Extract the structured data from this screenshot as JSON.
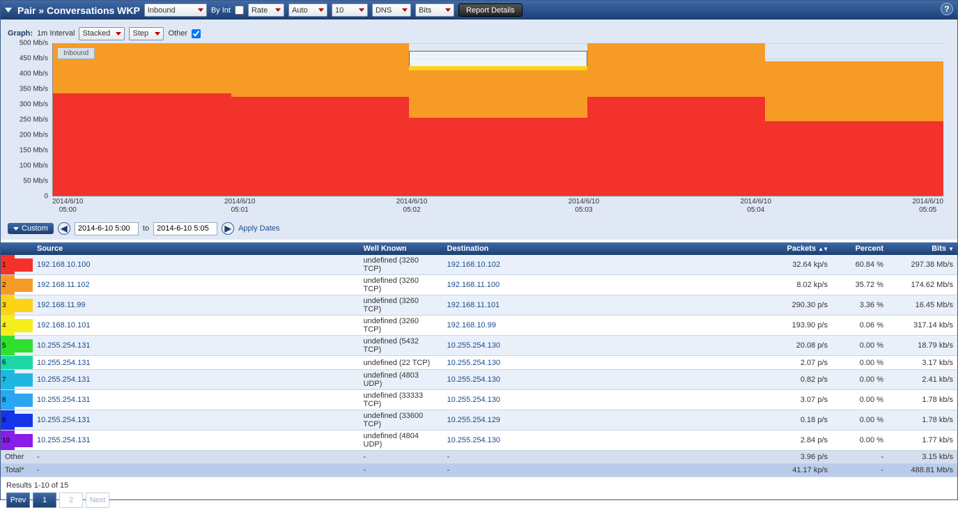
{
  "topbar": {
    "title": "Pair » Conversations WKP",
    "direction": "Inbound",
    "by_int_label": "By Int",
    "by_int_checked": false,
    "rate": "Rate",
    "auto": "Auto",
    "count": "10",
    "dns": "DNS",
    "units": "Bits",
    "report_btn": "Report Details"
  },
  "graph_ctrl": {
    "label": "Graph:",
    "interval": "1m Interval",
    "stack": "Stacked",
    "step": "Step",
    "other_label": "Other",
    "other_checked": true,
    "legend": "Inbound"
  },
  "chart_data": {
    "type": "area",
    "title": "",
    "xlabel": "",
    "ylabel": "",
    "ylim": [
      0,
      500
    ],
    "y_unit": "Mb/s",
    "y_ticks": [
      0,
      50,
      100,
      150,
      200,
      250,
      300,
      350,
      400,
      450,
      500
    ],
    "categories": [
      "2014/6/10 05:00",
      "2014/6/10 05:01",
      "2014/6/10 05:02",
      "2014/6/10 05:03",
      "2014/6/10 05:04",
      "2014/6/10 05:05"
    ],
    "series": [
      {
        "name": "192.168.10.100",
        "color": "#f3322c",
        "values": [
          335,
          325,
          255,
          325,
          245
        ]
      },
      {
        "name": "192.168.11.102",
        "color": "#f79b27",
        "values": [
          165,
          175,
          155,
          175,
          195
        ]
      },
      {
        "name": "192.168.11.99",
        "color": "#fdd315",
        "values": [
          0,
          0,
          15,
          0,
          0
        ]
      },
      {
        "name": "outline_total",
        "color": "#666",
        "values": [
          500,
          500,
          475,
          500,
          440
        ]
      }
    ]
  },
  "date_row": {
    "custom": "Custom",
    "from": "2014-6-10 5:00",
    "to_label": "to",
    "to": "2014-6-10 5:05",
    "apply": "Apply Dates"
  },
  "columns": {
    "source": "Source",
    "wk": "Well Known",
    "dest": "Destination",
    "packets": "Packets",
    "percent": "Percent",
    "bits": "Bits"
  },
  "rows": [
    {
      "idx": "1",
      "color": "#f3322c",
      "src": "192.168.10.100",
      "wk": "undefined (3260 TCP)",
      "dst": "192.168.10.102",
      "pkts": "32.64 kp/s",
      "pct": "60.84 %",
      "bits": "297.38 Mb/s"
    },
    {
      "idx": "2",
      "color": "#f79b27",
      "src": "192.168.11.102",
      "wk": "undefined (3260 TCP)",
      "dst": "192.168.11.100",
      "pkts": "8.02 kp/s",
      "pct": "35.72 %",
      "bits": "174.62 Mb/s"
    },
    {
      "idx": "3",
      "color": "#fdd315",
      "src": "192.168.11.99",
      "wk": "undefined (3260 TCP)",
      "dst": "192.168.11.101",
      "pkts": "290.30 p/s",
      "pct": "3.36 %",
      "bits": "16.45 Mb/s"
    },
    {
      "idx": "4",
      "color": "#f5ee1c",
      "src": "192.168.10.101",
      "wk": "undefined (3260 TCP)",
      "dst": "192.168.10.99",
      "pkts": "193.90 p/s",
      "pct": "0.06 %",
      "bits": "317.14 kb/s"
    },
    {
      "idx": "5",
      "color": "#2fe02f",
      "src": "10.255.254.131",
      "wk": "undefined (5432 TCP)",
      "dst": "10.255.254.130",
      "pkts": "20.08 p/s",
      "pct": "0.00 %",
      "bits": "18.79 kb/s"
    },
    {
      "idx": "6",
      "color": "#1fd7a4",
      "src": "10.255.254.131",
      "wk": "undefined (22 TCP)",
      "dst": "10.255.254.130",
      "pkts": "2.07 p/s",
      "pct": "0.00 %",
      "bits": "3.17 kb/s"
    },
    {
      "idx": "7",
      "color": "#1fb7e0",
      "src": "10.255.254.131",
      "wk": "undefined (4803 UDP)",
      "dst": "10.255.254.130",
      "pkts": "0.82 p/s",
      "pct": "0.00 %",
      "bits": "2.41 kb/s"
    },
    {
      "idx": "8",
      "color": "#2aa7f0",
      "src": "10.255.254.131",
      "wk": "undefined (33333 TCP)",
      "dst": "10.255.254.130",
      "pkts": "3.07 p/s",
      "pct": "0.00 %",
      "bits": "1.78 kb/s"
    },
    {
      "idx": "9",
      "color": "#1336e8",
      "src": "10.255.254.131",
      "wk": "undefined (33600 TCP)",
      "dst": "10.255.254.129",
      "pkts": "0.18 p/s",
      "pct": "0.00 %",
      "bits": "1.78 kb/s"
    },
    {
      "idx": "10",
      "color": "#8a1de8",
      "src": "10.255.254.131",
      "wk": "undefined (4804 UDP)",
      "dst": "10.255.254.130",
      "pkts": "2.84 p/s",
      "pct": "0.00 %",
      "bits": "1.77 kb/s"
    }
  ],
  "other_row": {
    "label": "Other",
    "src": "-",
    "wk": "-",
    "dst": "-",
    "pkts": "3.96 p/s",
    "pct": "-",
    "bits": "3.15 kb/s"
  },
  "total_row": {
    "label": "Total*",
    "src": "-",
    "wk": "-",
    "dst": "-",
    "pkts": "41.17 kp/s",
    "pct": "-",
    "bits": "488.81 Mb/s"
  },
  "pager": {
    "results": "Results 1-10 of 15",
    "prev": "Prev",
    "p1": "1",
    "p2": "2",
    "next": "Next"
  }
}
